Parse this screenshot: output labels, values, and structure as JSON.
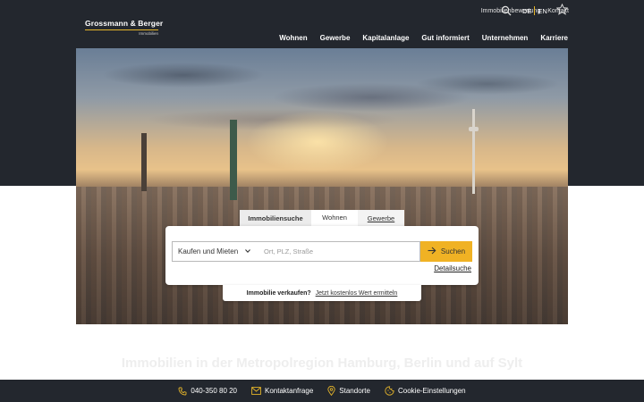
{
  "header": {
    "logo": {
      "name": "Grossmann & Berger",
      "sub": "Immobilien"
    },
    "utility_links": [
      "Immobilienbewertung",
      "Kontakt"
    ],
    "languages": [
      "DE",
      "EN"
    ],
    "nav": [
      "Wohnen",
      "Gewerbe",
      "Kapitalanlage",
      "Gut informiert",
      "Unternehmen",
      "Karriere"
    ]
  },
  "search": {
    "tabs": [
      "Immobiliensuche",
      "Wohnen",
      "Gewerbe"
    ],
    "type_select": "Kaufen und Mieten",
    "location_placeholder": "Ort, PLZ, Straße",
    "button": "Suchen",
    "detail_link": "Detailsuche"
  },
  "sell": {
    "label": "Immobilie verkaufen?",
    "link": "Jetzt kostenlos Wert ermitteln"
  },
  "headline": "Immobilien in der Metropolregion Hamburg, Berlin und auf Sylt",
  "footer": {
    "items": [
      "040-350 80 20",
      "Kontaktanfrage",
      "Standorte",
      "Cookie-Einstellungen"
    ]
  },
  "colors": {
    "dark": "#23272e",
    "accent": "#f0b224"
  },
  "icons": [
    "search-icon",
    "star-icon",
    "chevron-down-icon",
    "arrow-right-icon",
    "phone-icon",
    "mail-icon",
    "location-icon",
    "cookie-icon"
  ]
}
